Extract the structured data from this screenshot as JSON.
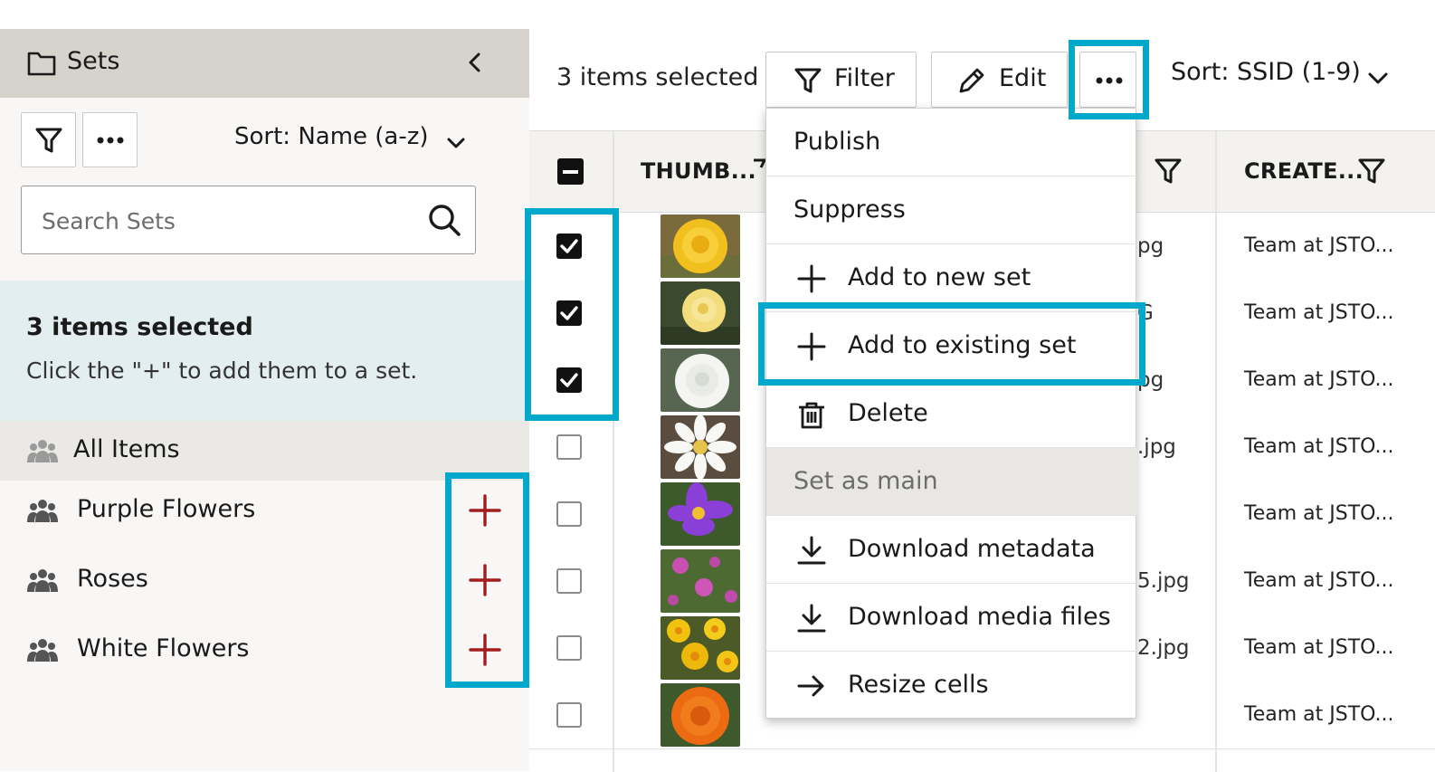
{
  "sidebar": {
    "title": "Sets",
    "sort_label": "Sort: Name (a-z)",
    "search_placeholder": "Search Sets",
    "info_title": "3 items selected",
    "info_text": "Click the \"+\" to add them to a set.",
    "items": [
      {
        "label": "All Items",
        "selected": true
      },
      {
        "label": "Purple Flowers"
      },
      {
        "label": "Roses"
      },
      {
        "label": "White Flowers"
      }
    ]
  },
  "toolbar": {
    "count": "3 items selected",
    "filter_label": "Filter",
    "edit_label": "Edit",
    "sort_label": "Sort: SSID (1-9)"
  },
  "table": {
    "col_thumb": "THUMB...",
    "col_created": "CREATE...",
    "rows": [
      {
        "checked": true,
        "fname": "pg",
        "creator": "Team at JSTO..."
      },
      {
        "checked": true,
        "fname": "G",
        "creator": "Team at JSTO..."
      },
      {
        "checked": true,
        "fname": "pg",
        "creator": "Team at JSTO..."
      },
      {
        "checked": false,
        "fname": ".jpg",
        "creator": "Team at JSTO..."
      },
      {
        "checked": false,
        "fname": "",
        "creator": "Team at JSTO..."
      },
      {
        "checked": false,
        "fname": "5.jpg",
        "creator": "Team at JSTO..."
      },
      {
        "checked": false,
        "fname": "2.jpg",
        "creator": "Team at JSTO..."
      },
      {
        "checked": false,
        "fname": "",
        "creator": "Team at JSTO..."
      }
    ]
  },
  "menu": {
    "items": [
      {
        "label": "Publish"
      },
      {
        "label": "Suppress"
      },
      {
        "label": "Add to new set"
      },
      {
        "label": "Add to existing set"
      },
      {
        "label": "Delete"
      },
      {
        "label": "Set as main",
        "disabled": true
      },
      {
        "label": "Download metadata"
      },
      {
        "label": "Download media files"
      },
      {
        "label": "Resize cells"
      }
    ]
  },
  "colors": {
    "highlight": "#00a9cc",
    "plus": "#a31d1d",
    "sidebar_header": "#d6d3cc",
    "info_bg": "#e3eef0"
  }
}
